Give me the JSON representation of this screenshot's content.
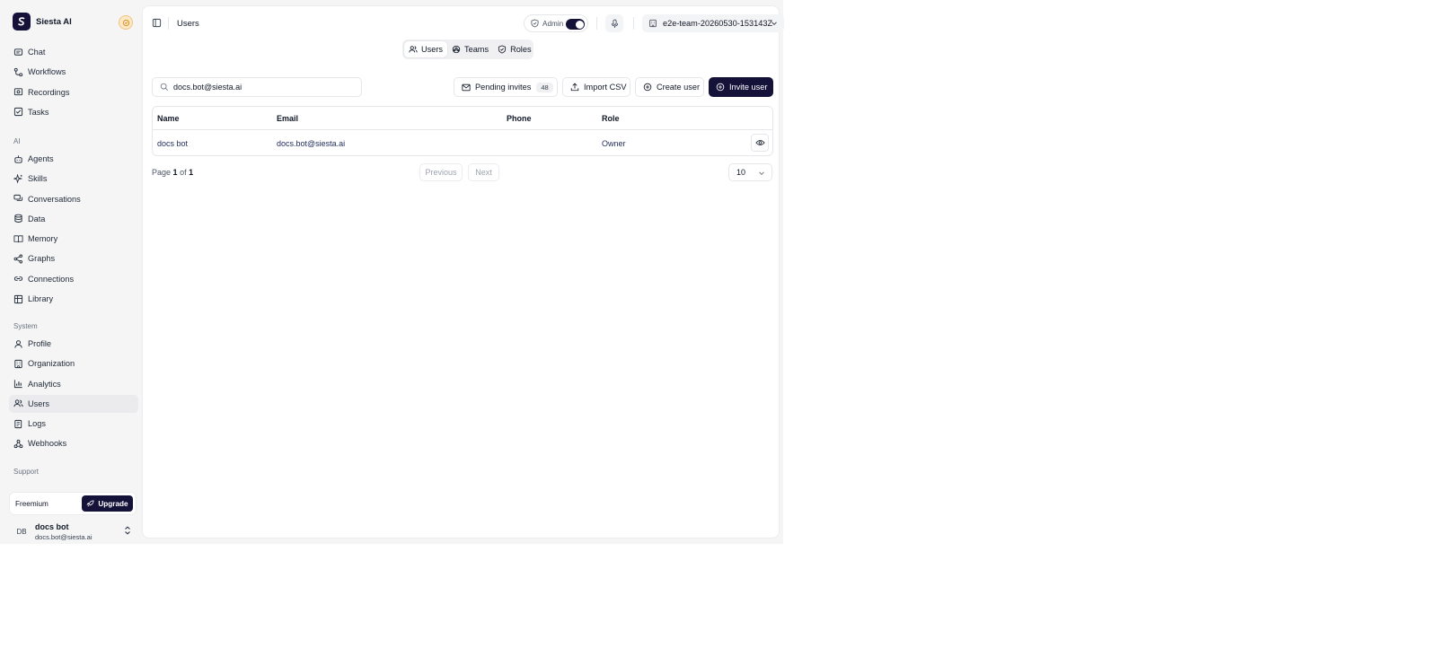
{
  "brand": {
    "name": "Siesta AI",
    "accent": "#15123a"
  },
  "nav_primary": [
    {
      "label": "Chat",
      "icon": "chat-icon"
    },
    {
      "label": "Workflows",
      "icon": "workflow-icon"
    },
    {
      "label": "Recordings",
      "icon": "recording-icon"
    },
    {
      "label": "Tasks",
      "icon": "tasks-icon"
    }
  ],
  "nav_ai_label": "AI",
  "nav_ai": [
    {
      "label": "Agents",
      "icon": "bot-icon"
    },
    {
      "label": "Skills",
      "icon": "sparkles-icon"
    },
    {
      "label": "Conversations",
      "icon": "messages-icon"
    },
    {
      "label": "Data",
      "icon": "database-icon"
    },
    {
      "label": "Memory",
      "icon": "book-icon"
    },
    {
      "label": "Graphs",
      "icon": "graph-icon"
    },
    {
      "label": "Connections",
      "icon": "link-icon"
    },
    {
      "label": "Library",
      "icon": "library-icon"
    }
  ],
  "nav_system_label": "System",
  "nav_system": [
    {
      "label": "Profile",
      "icon": "user-icon"
    },
    {
      "label": "Organization",
      "icon": "building-icon"
    },
    {
      "label": "Analytics",
      "icon": "chart-icon"
    },
    {
      "label": "Users",
      "icon": "users-icon",
      "active": true
    },
    {
      "label": "Logs",
      "icon": "logs-icon"
    },
    {
      "label": "Webhooks",
      "icon": "webhook-icon"
    }
  ],
  "nav_support_label": "Support",
  "plan": {
    "name": "Freemium",
    "upgrade_label": "Upgrade"
  },
  "current_user": {
    "initials": "DB",
    "name": "docs bot",
    "email": "docs.bot@siesta.ai"
  },
  "header": {
    "title": "Users",
    "admin_label": "Admin",
    "admin_enabled": true,
    "team": "e2e-team-20260530-153143Z"
  },
  "tabs": [
    {
      "label": "Users",
      "icon": "users-icon",
      "active": true
    },
    {
      "label": "Teams",
      "icon": "teams-icon"
    },
    {
      "label": "Roles",
      "icon": "shield-icon"
    }
  ],
  "toolbar": {
    "search_value": "docs.bot@siesta.ai",
    "pending_label": "Pending invites",
    "pending_count": "48",
    "import_label": "Import CSV",
    "create_label": "Create user",
    "invite_label": "Invite user"
  },
  "table": {
    "columns": [
      "Name",
      "Email",
      "Phone",
      "Role"
    ],
    "rows": [
      {
        "name": "docs bot",
        "email": "docs.bot@siesta.ai",
        "phone": "",
        "role": "Owner"
      }
    ]
  },
  "pagination": {
    "page_word": "Page",
    "current": "1",
    "of_word": "of",
    "total": "1",
    "prev_label": "Previous",
    "next_label": "Next",
    "page_size": "10"
  }
}
